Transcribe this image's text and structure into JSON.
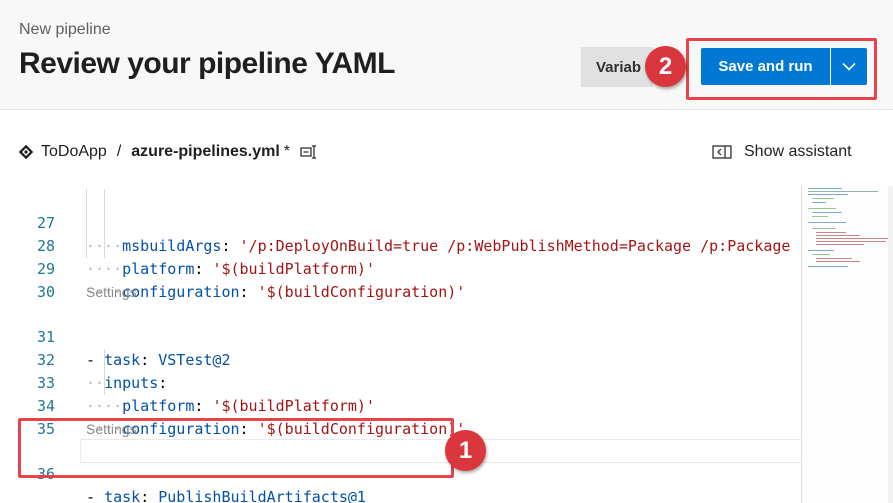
{
  "header": {
    "subtitle": "New pipeline",
    "title": "Review your pipeline YAML",
    "variables_label": "Variab",
    "save_run_label": "Save and run"
  },
  "callouts": {
    "one": "1",
    "two": "2"
  },
  "breadcrumb": {
    "repo": "ToDoApp",
    "separator": "/",
    "file": "azure-pipelines.yml",
    "modified_marker": "*"
  },
  "assistant": {
    "label": "Show assistant"
  },
  "editor": {
    "codelens_label": "Settings",
    "lines": [
      {
        "num": "27",
        "key": "msbuildArgs",
        "value": "'/p:DeployOnBuild=true /p:WebPublishMethod=Package /p:Package"
      },
      {
        "num": "28",
        "key": "platform",
        "value": "'$(buildPlatform)'"
      },
      {
        "num": "29",
        "key": "configuration",
        "value": "'$(buildConfiguration)'"
      },
      {
        "num": "30"
      },
      {
        "num": "31",
        "key": "task",
        "value": "VSTest@2"
      },
      {
        "num": "32",
        "key": "inputs"
      },
      {
        "num": "33",
        "key": "platform",
        "value": "'$(buildPlatform)'"
      },
      {
        "num": "34",
        "key": "configuration",
        "value": "'$(buildConfiguration)'"
      },
      {
        "num": "35"
      },
      {
        "num": "36",
        "key": "task",
        "value": "PublishBuildArtifacts@1"
      }
    ]
  },
  "icons": {
    "repo": "git-diamond-icon",
    "file_edit": "rename-file-icon",
    "assistant": "panel-toggle-icon",
    "dropdown": "chevron-down-icon"
  },
  "colors": {
    "primary": "#0078d4",
    "callout": "#d9363e",
    "highlight_border": "#e8434a",
    "yaml_key": "#0451a5",
    "yaml_string": "#a31515",
    "line_number": "#237893"
  }
}
